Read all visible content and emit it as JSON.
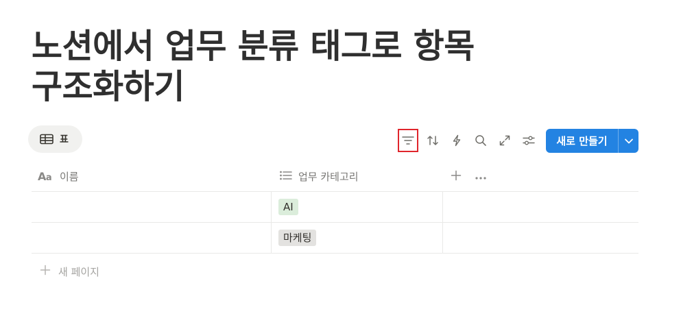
{
  "page": {
    "title": "노션에서 업무 분류 태그로 항목 구조화하기"
  },
  "views": {
    "active_label": "표"
  },
  "toolbar": {
    "icons": [
      "filter-icon",
      "sort-icon",
      "automation-icon",
      "search-icon",
      "expand-icon",
      "settings-icon"
    ],
    "new_label": "새로 만들기"
  },
  "table": {
    "columns": [
      {
        "label": "이름",
        "icon": "title-aa-icon"
      },
      {
        "label": "업무 카테고리",
        "icon": "list-icon"
      }
    ],
    "rows": [
      {
        "name": "",
        "category": "AI",
        "tag_color": "#dbeddb"
      },
      {
        "name": "",
        "category": "마케팅",
        "tag_color": "#e3e2e0"
      }
    ],
    "new_page_label": "새 페이지"
  },
  "colors": {
    "accent": "#2383e2",
    "highlight": "#e0252c"
  }
}
